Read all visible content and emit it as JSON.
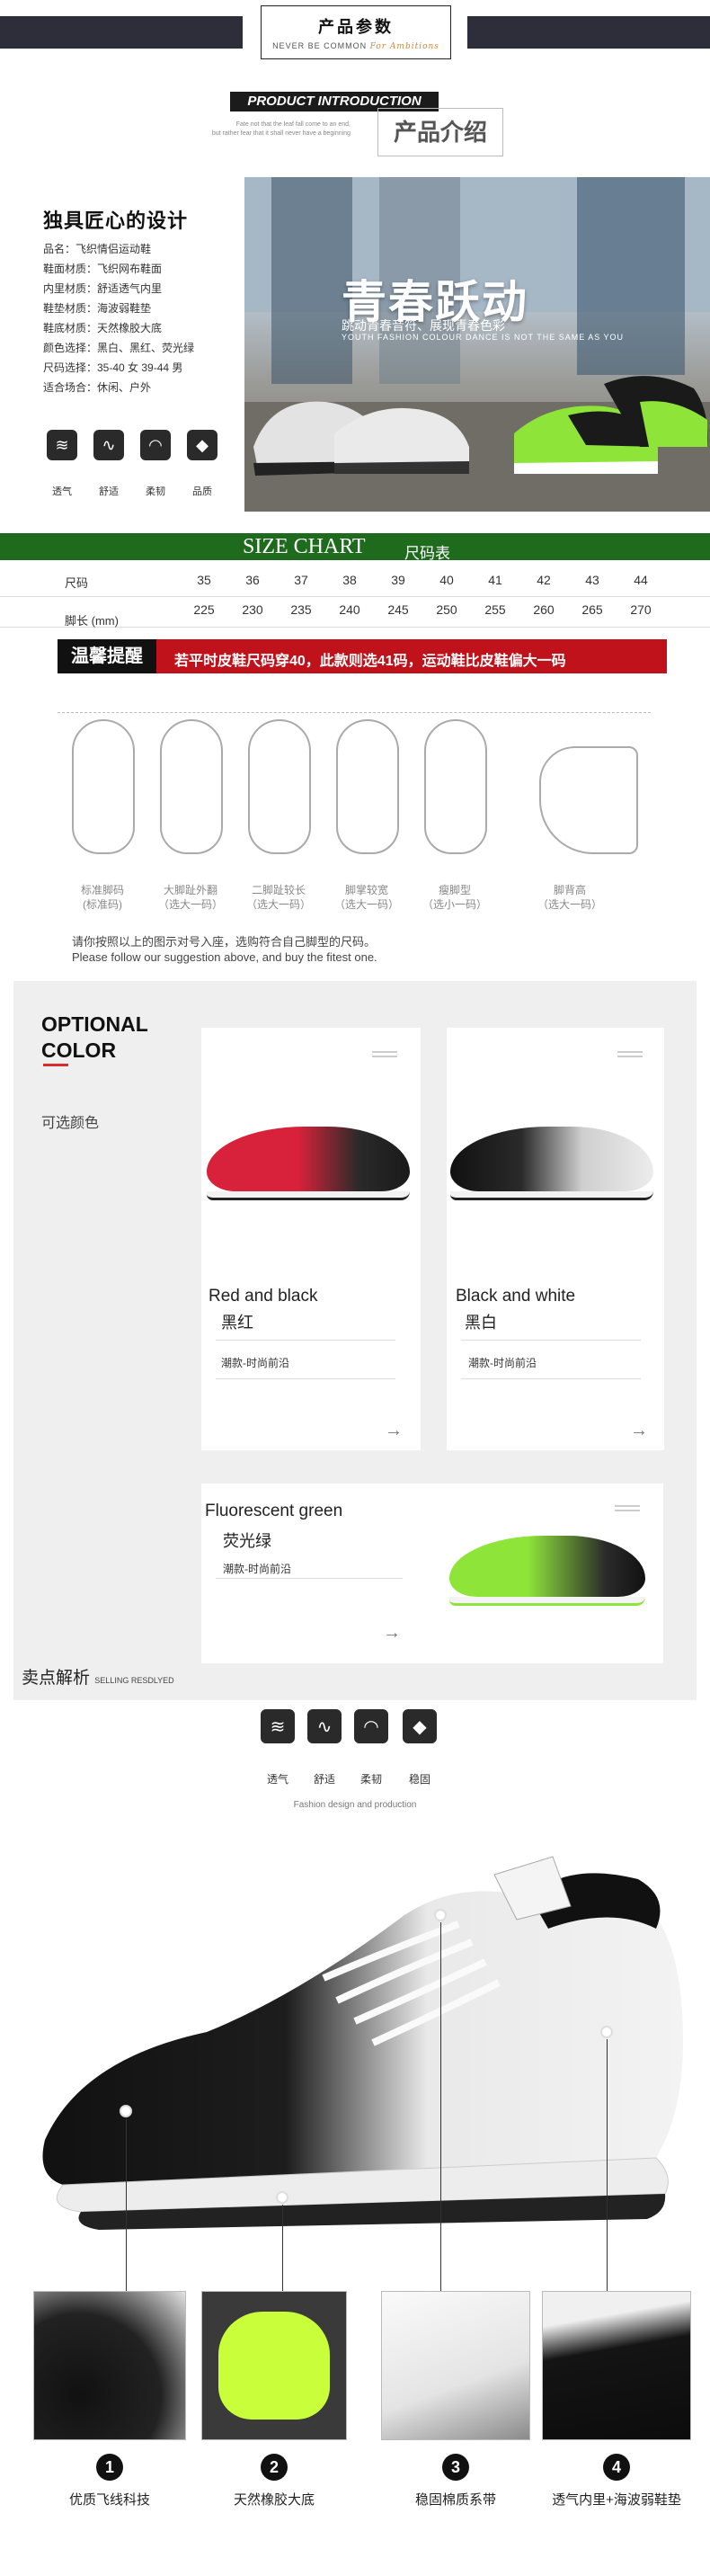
{
  "header": {
    "title": "产品参数",
    "subtitle_prefix": "NEVER BE COMMON",
    "subtitle_script": "For Ambitions"
  },
  "intro": {
    "tag": "PRODUCT INTRODUCTION",
    "small_text_1": "Fate not that the leaf fall come to an end,",
    "small_text_2": "but rather fear that it shall never have a beginning",
    "cn_label": "产品介绍"
  },
  "details": {
    "title": "独具匠心的设计",
    "lines": [
      "品名：飞织情侣运动鞋",
      "鞋面材质：飞织网布鞋面",
      "内里材质：舒适透气内里",
      "鞋垫材质：海波弱鞋垫",
      "鞋底材质：天然橡胶大底",
      "颜色选择：黑白、黑红、荧光绿",
      "尺码选择：35-40 女  39-44 男",
      "适合场合：休闲、户外"
    ],
    "features": [
      "透气",
      "舒适",
      "柔韧",
      "品质"
    ]
  },
  "hero": {
    "headline": "青春跃动",
    "line2": "跳动青春音符、展现青春色彩",
    "line3": "YOUTH FASHION COLOUR DANCE IS NOT THE SAME AS YOU"
  },
  "size_chart": {
    "title_en": "SIZE CHART",
    "title_cn": "尺码表",
    "row_size_label": "尺码",
    "row_length_label": "脚长 (mm)",
    "sizes": [
      "35",
      "36",
      "37",
      "38",
      "39",
      "40",
      "41",
      "42",
      "43",
      "44"
    ],
    "lengths": [
      "225",
      "230",
      "235",
      "240",
      "245",
      "250",
      "255",
      "260",
      "265",
      "270"
    ]
  },
  "warning": {
    "tag": "温馨提醒",
    "text": "若平时皮鞋尺码穿40，此款则选41码，运动鞋比皮鞋偏大一码"
  },
  "feet": [
    {
      "name": "标准脚码",
      "note": "(标准码)"
    },
    {
      "name": "大脚趾外翻",
      "note": "（选大一码）"
    },
    {
      "name": "二脚趾较长",
      "note": "（选大一码）"
    },
    {
      "name": "脚掌较宽",
      "note": "（选大一码）"
    },
    {
      "name": "瘦脚型",
      "note": "（选小一码）"
    },
    {
      "name": "脚背高",
      "note": "（选大一码）"
    }
  ],
  "feet_note_cn": "请你按照以上的图示对号入座，选购符合自己脚型的尺码。",
  "feet_note_en": "Please follow our suggestion above, and buy the fitest one.",
  "colors": {
    "title_line1": "OPTIONAL",
    "title_line2": "COLOR",
    "subtitle": "可选颜色",
    "cards": [
      {
        "en": "Red and black",
        "cn": "黑红",
        "tag": "潮款-时尚前沿",
        "arrow": "→"
      },
      {
        "en": "Black and white",
        "cn": "黑白",
        "tag": "潮款-时尚前沿",
        "arrow": "→"
      },
      {
        "en": "Fluorescent green",
        "cn": "荧光绿",
        "tag": "潮款-时尚前沿",
        "arrow": "→"
      }
    ]
  },
  "selling": {
    "title": "卖点解析",
    "sub": "SELLING RESDLYED",
    "features": [
      "透气",
      "舒适",
      "柔韧",
      "稳固"
    ],
    "note": "Fashion design and production"
  },
  "details_bottom": [
    {
      "num": "1",
      "label": "优质飞线科技"
    },
    {
      "num": "2",
      "label": "天然橡胶大底"
    },
    {
      "num": "3",
      "label": "稳固棉质系带"
    },
    {
      "num": "4",
      "label": "透气内里+海波弱鞋垫"
    }
  ],
  "colors_hex": {
    "green_bar": "#1f6b1e",
    "red_bar": "#c0121a",
    "accent_red": "#d92d2d",
    "fluor": "#8fe43a"
  }
}
